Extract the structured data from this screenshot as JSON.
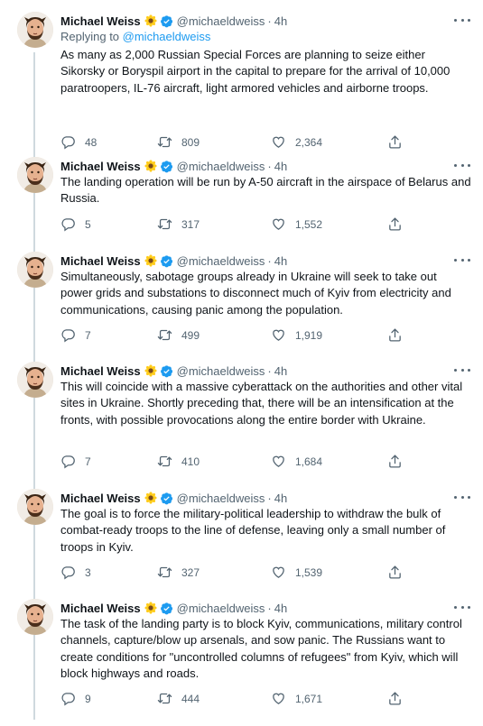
{
  "colors": {
    "accent": "#1d9bf0",
    "text": "#0f1419",
    "muted": "#536471",
    "thread_line": "#cfd9de"
  },
  "tweets": [
    {
      "name": "Michael Weiss",
      "handle": "@michaeldweiss",
      "sep": "·",
      "time": "4h",
      "replying_prefix": "Replying to ",
      "replying_to": "@michaeldweiss",
      "text": "As many as 2,000 Russian Special Forces are planning to seize either Sikorsky or Boryspil airport in the capital to prepare for the arrival of 10,000 paratroopers, IL-76 aircraft, light armored vehicles and airborne troops.",
      "replies": "48",
      "retweets": "809",
      "likes": "2,364"
    },
    {
      "name": "Michael Weiss",
      "handle": "@michaeldweiss",
      "sep": "·",
      "time": "4h",
      "text": "The landing operation will be run by A-50 aircraft in the airspace of Belarus and Russia.",
      "replies": "5",
      "retweets": "317",
      "likes": "1,552"
    },
    {
      "name": "Michael Weiss",
      "handle": "@michaeldweiss",
      "sep": "·",
      "time": "4h",
      "text": "Simultaneously, sabotage groups already in Ukraine will seek to take out power grids and substations to disconnect much of Kyiv from electricity and communications, causing panic among the population.",
      "replies": "7",
      "retweets": "499",
      "likes": "1,919"
    },
    {
      "name": "Michael Weiss",
      "handle": "@michaeldweiss",
      "sep": "·",
      "time": "4h",
      "text": "This will coincide with a massive cyberattack on the authorities and other vital sites in Ukraine. Shortly preceding that, there will be an intensification at the fronts, with possible provocations along the entire border with Ukraine.",
      "replies": "7",
      "retweets": "410",
      "likes": "1,684"
    },
    {
      "name": "Michael Weiss",
      "handle": "@michaeldweiss",
      "sep": "·",
      "time": "4h",
      "text": "The goal is to force the military-political leadership to withdraw the bulk of combat-ready troops to the line of defense, leaving only a small number of troops in Kyiv.",
      "replies": "3",
      "retweets": "327",
      "likes": "1,539"
    },
    {
      "name": "Michael Weiss",
      "handle": "@michaeldweiss",
      "sep": "·",
      "time": "4h",
      "text": "The task of the landing party is to block Kyiv, communications, military control channels, capture/blow up arsenals, and sow panic. The Russians want to create conditions for \"uncontrolled columns of refugees\" from Kyiv, which will block highways and roads.",
      "replies": "9",
      "retweets": "444",
      "likes": "1,671"
    }
  ]
}
